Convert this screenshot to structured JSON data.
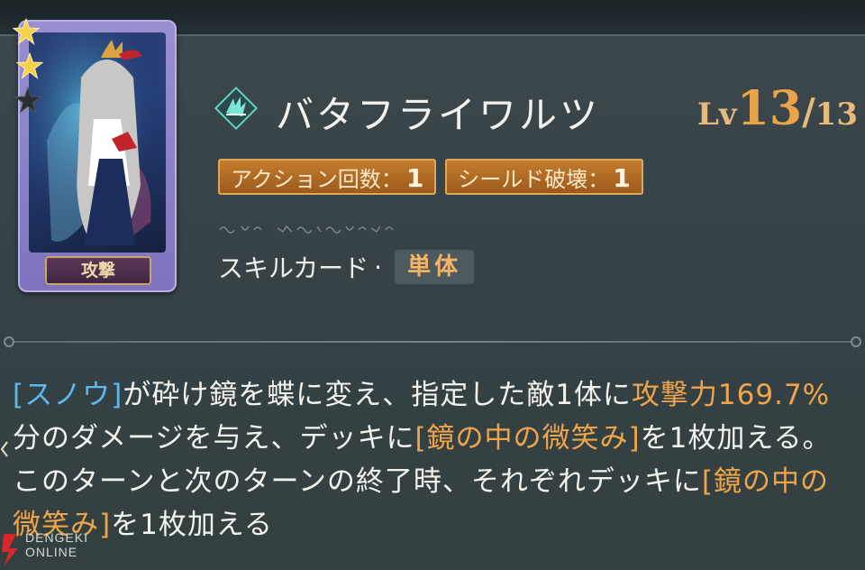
{
  "card": {
    "label": "攻撃",
    "rarity_stars_lit": 2,
    "rarity_stars_total": 3
  },
  "skill": {
    "icon": "skill-wing-icon",
    "name": "バタフライワルツ",
    "level_prefix": "Lv",
    "level_current": "13",
    "level_separator": "/",
    "level_max": "13",
    "tags": [
      {
        "label": "アクション回数：",
        "value": "1"
      },
      {
        "label": "シールド破壊：",
        "value": "1"
      }
    ],
    "card_type_label": "スキルカード",
    "card_type_separator": "·",
    "target": "単体"
  },
  "description": {
    "p1": "[スノウ]",
    "p2": "が砕け鏡を蝶に変え、指定した敵1体に",
    "p3": "攻撃力169.7%",
    "p4": "分のダメージを与え、デッキに",
    "p5": "[鏡の中の微笑み]",
    "p6": "を1枚加える。このターンと次のターンの終了時、それぞれデッキに",
    "p7": "[鏡の中の微笑み]",
    "p8": "を1枚加える"
  },
  "watermark": {
    "line1": "DENGEKI",
    "line2": "ONLINE"
  },
  "colors": {
    "accent_orange": "#f0a54a",
    "link_blue": "#5eb8f0",
    "tag_bg": "#b06a24"
  }
}
